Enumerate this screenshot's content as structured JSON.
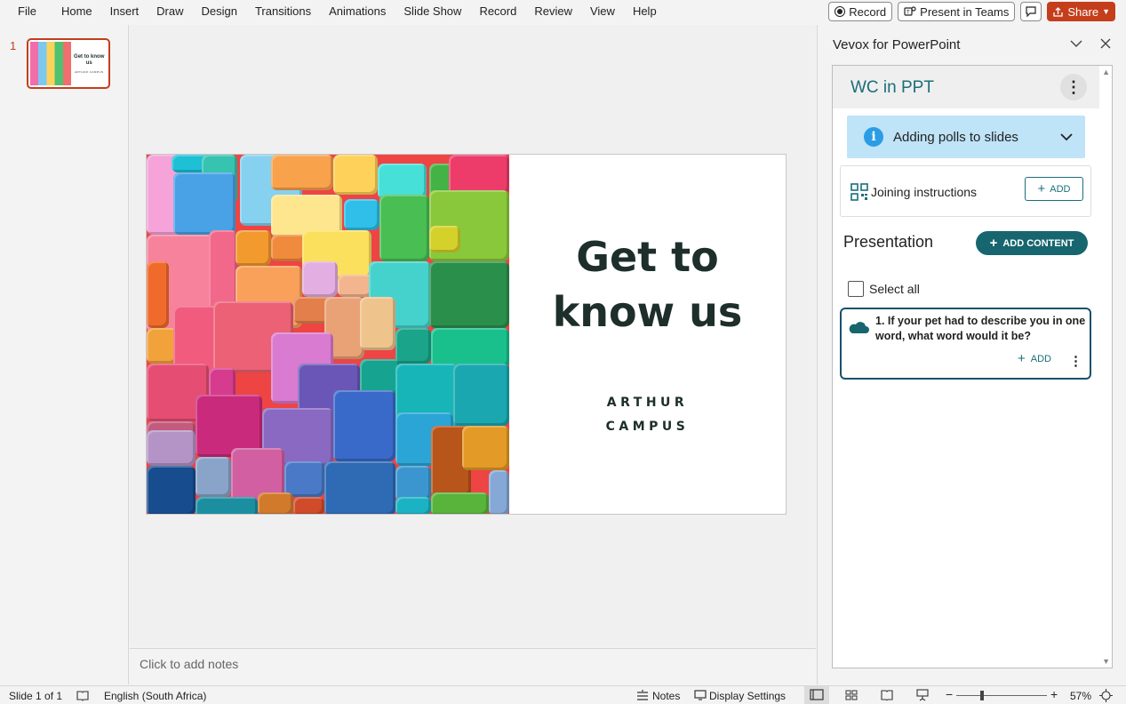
{
  "menu": {
    "items": [
      "File",
      "Home",
      "Insert",
      "Draw",
      "Design",
      "Transitions",
      "Animations",
      "Slide Show",
      "Record",
      "Review",
      "View",
      "Help"
    ],
    "record_label": "Record",
    "present_teams_label": "Present in Teams",
    "share_label": "Share"
  },
  "thumbnails": {
    "slide_number": "1",
    "title": "Get to know us",
    "subtitle": "ARTHUR CAMPUS"
  },
  "slide": {
    "title_line1": "Get to",
    "title_line2": "know us",
    "subtitle_line1": "ARTHUR",
    "subtitle_line2": "CAMPUS"
  },
  "notes": {
    "placeholder": "Click to add notes"
  },
  "taskpane": {
    "title": "Vevox for PowerPoint",
    "header_title": "WC in PPT",
    "info_banner": "Adding polls to slides",
    "joining_label": "Joining instructions",
    "add_label": "ADD",
    "presentation_title": "Presentation",
    "add_content_label": "ADD CONTENT",
    "select_all_label": "Select all",
    "poll": {
      "text": "1. If your pet had to describe you in one word, what word would it be?",
      "add_label": "ADD"
    },
    "accent_color": "#1b6e79"
  },
  "statusbar": {
    "slide_info": "Slide 1 of 1",
    "language": "English (South Africa)",
    "notes_label": "Notes",
    "display_settings_label": "Display Settings",
    "zoom": "57%"
  }
}
